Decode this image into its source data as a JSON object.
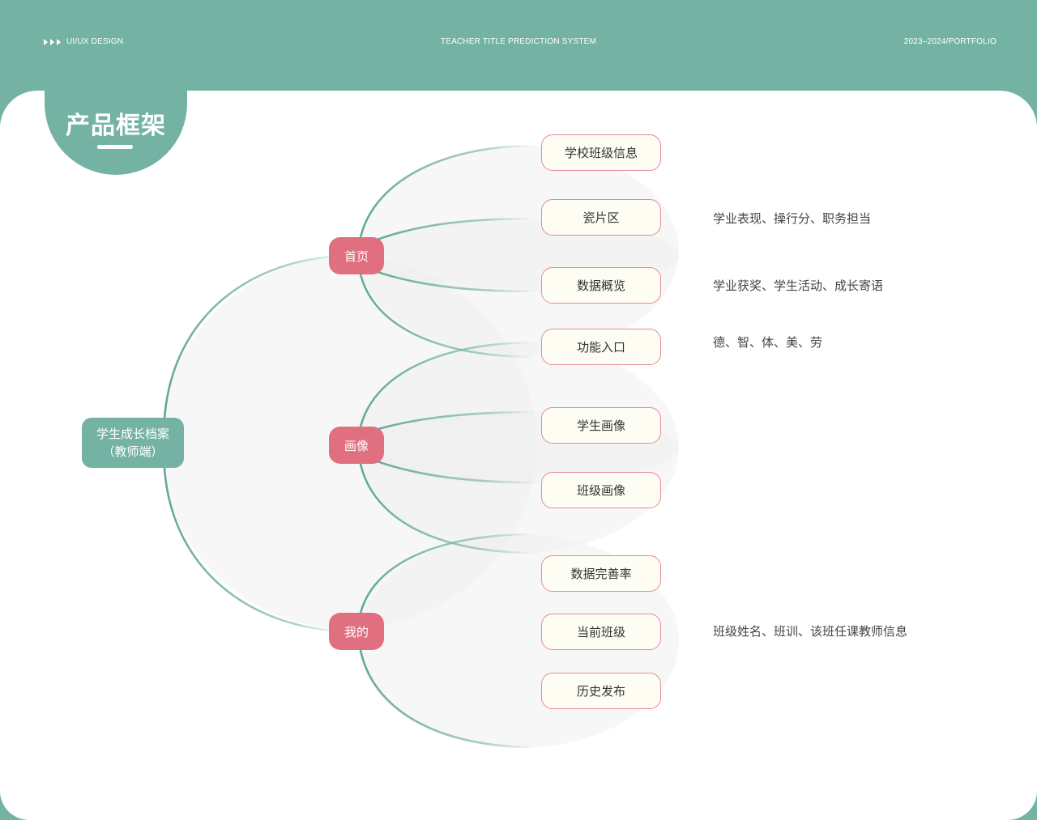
{
  "header": {
    "left_label": "UI/UX DESIGN",
    "center_label": "TEACHER TITLE PREDICTION SYSTEM",
    "right_label": "2023–2024/PORTFOLIO"
  },
  "section_title": "产品框架",
  "colors": {
    "primary": "#74b3a4",
    "branch": "#e06f80",
    "leaf_border": "#e58a97",
    "leaf_fill": "#fdfdf3"
  },
  "mindmap": {
    "root": {
      "line1": "学生成长档案",
      "line2": "（教师端）"
    },
    "branches": [
      {
        "label": "首页",
        "leaves": [
          {
            "label": "学校班级信息",
            "note": ""
          },
          {
            "label": "瓷片区",
            "note": "学业表现、操行分、职务担当"
          },
          {
            "label": "数据概览",
            "note": "学业获奖、学生活动、成长寄语"
          },
          {
            "label": "功能入口",
            "note": "德、智、体、美、劳"
          }
        ]
      },
      {
        "label": "画像",
        "leaves": [
          {
            "label": "学生画像",
            "note": ""
          },
          {
            "label": "班级画像",
            "note": ""
          }
        ]
      },
      {
        "label": "我的",
        "leaves": [
          {
            "label": "数据完善率",
            "note": ""
          },
          {
            "label": "当前班级",
            "note": "班级姓名、班训、该班任课教师信息"
          },
          {
            "label": "历史发布",
            "note": ""
          }
        ]
      }
    ]
  }
}
